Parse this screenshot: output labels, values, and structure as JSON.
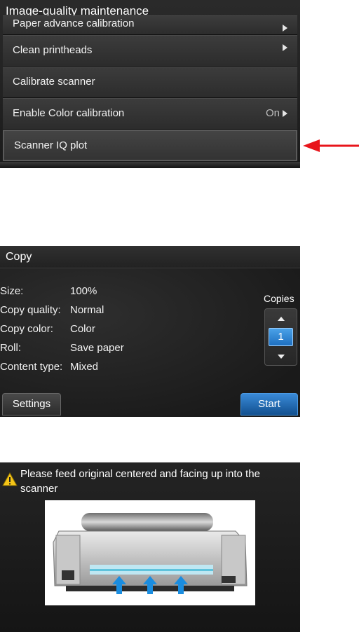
{
  "maintenance": {
    "title": "Image-quality maintenance",
    "items": [
      {
        "label": "Paper advance calibration",
        "value": ""
      },
      {
        "label": "Clean printheads",
        "value": ""
      },
      {
        "label": "Calibrate scanner",
        "value": ""
      },
      {
        "label": "Enable Color calibration",
        "value": "On"
      },
      {
        "label": "Scanner IQ plot",
        "value": ""
      }
    ]
  },
  "copy": {
    "title": "Copy",
    "fields": [
      {
        "label": "Size:",
        "value": "100%"
      },
      {
        "label": "Copy quality:",
        "value": "Normal"
      },
      {
        "label": "Copy color:",
        "value": "Color"
      },
      {
        "label": "Roll:",
        "value": "Save paper"
      },
      {
        "label": "Content type:",
        "value": "Mixed"
      }
    ],
    "copies_label": "Copies",
    "copies_value": "1",
    "settings_label": "Settings",
    "start_label": "Start"
  },
  "scan": {
    "message": "Please feed original centered and facing up into the scanner"
  },
  "colors": {
    "arrow_red": "#e8151b",
    "accent_blue": "#1e6fc0",
    "feed_arrow_blue": "#1a8de0"
  }
}
